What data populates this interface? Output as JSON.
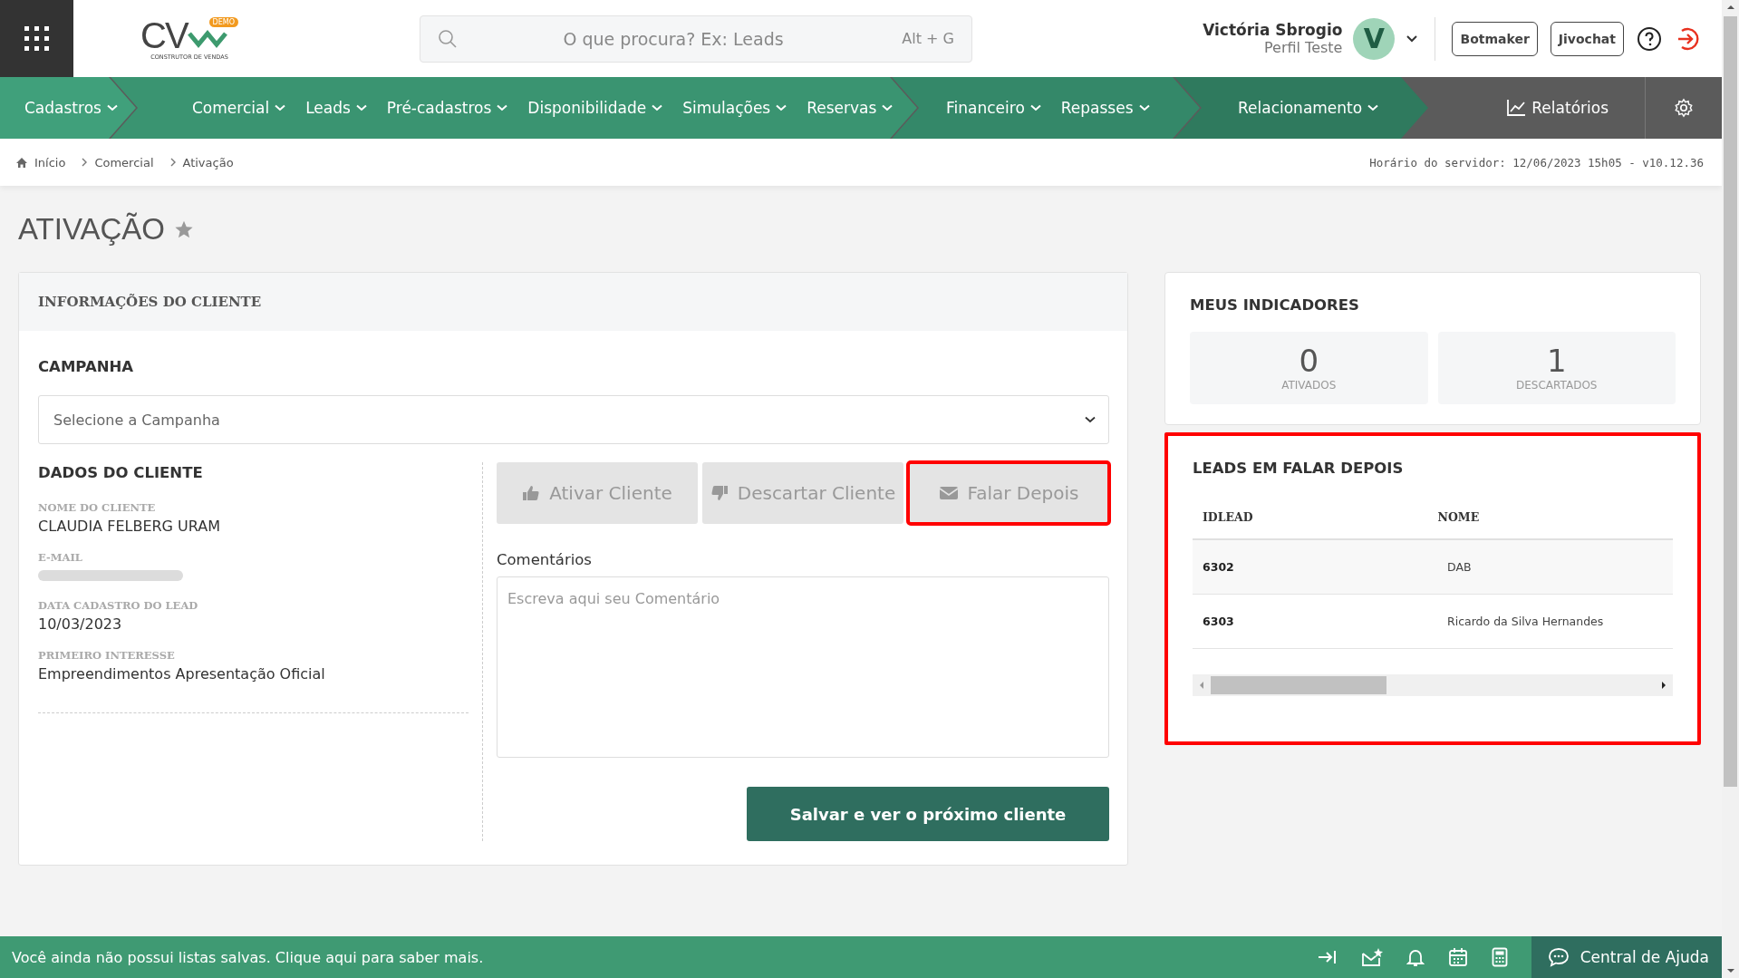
{
  "header": {
    "logo": {
      "text": "CV",
      "badge": "DEMO",
      "tagline": "CONSTRUTOR DE VENDAS"
    },
    "search": {
      "placeholder": "O que procura? Ex: Leads",
      "shortcut": "Alt + G"
    },
    "user": {
      "name": "Victória Sbrogio",
      "profile": "Perfil Teste",
      "initial": "V"
    },
    "buttons": [
      "Botmaker",
      "Jivochat"
    ]
  },
  "nav": {
    "groups": [
      {
        "items": [
          "Cadastros"
        ]
      },
      {
        "items": [
          "Comercial",
          "Leads",
          "Pré-cadastros",
          "Disponibilidade",
          "Simulações",
          "Reservas"
        ]
      },
      {
        "items": [
          "Financeiro",
          "Repasses"
        ]
      },
      {
        "items": [
          "Relacionamento"
        ]
      }
    ],
    "reports": "Relatórios"
  },
  "breadcrumb": [
    "Início",
    "Comercial",
    "Ativação"
  ],
  "server_time": "Horário do servidor: 12/06/2023 15h05 - v10.12.36",
  "page_title": "ATIVAÇÃO",
  "client_card": {
    "title": "INFORMAÇÕES DO CLIENTE",
    "campaign_label": "CAMPANHA",
    "campaign_placeholder": "Selecione a Campanha",
    "client_title": "DADOS DO CLIENTE",
    "fields": [
      {
        "label": "NOME DO CLIENTE",
        "value": "CLAUDIA FELBERG URAM",
        "redacted": false
      },
      {
        "label": "E-MAIL",
        "redacted": true
      },
      {
        "label": "DATA CADASTRO DO LEAD",
        "value": "10/03/2023",
        "redacted": false
      },
      {
        "label": "PRIMEIRO INTERESSE",
        "value": "Empreendimentos Apresentação Oficial",
        "redacted": false
      }
    ],
    "actions": [
      {
        "kind": "like",
        "label": "Ativar Cliente",
        "highlighted": false
      },
      {
        "kind": "dislike",
        "label": "Descartar Cliente",
        "highlighted": false
      },
      {
        "kind": "mail",
        "label": "Falar Depois",
        "highlighted": true
      }
    ],
    "comments_label": "Comentários",
    "comments_placeholder": "Escreva aqui seu Comentário",
    "save": "Salvar e ver o próximo cliente"
  },
  "indicators": {
    "title": "MEUS INDICADORES",
    "stats": [
      {
        "value": "0",
        "label": "ATIVADOS"
      },
      {
        "value": "1",
        "label": "DESCARTADOS"
      }
    ]
  },
  "leads_panel": {
    "title": "LEADS EM FALAR DEPOIS",
    "highlighted": true,
    "columns": [
      "IDLEAD",
      "NOME"
    ],
    "rows": [
      {
        "id": "6302",
        "name": "DAB"
      },
      {
        "id": "6303",
        "name": "Ricardo da Silva Hernandes"
      }
    ]
  },
  "bottom_bar": {
    "message": "Você ainda não possui listas salvas. Clique aqui para saber mais.",
    "help": "Central de Ajuda"
  }
}
